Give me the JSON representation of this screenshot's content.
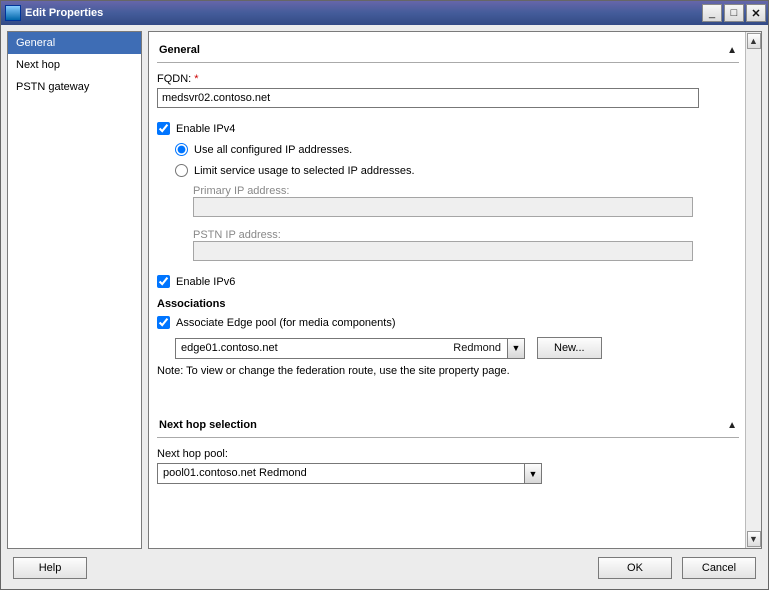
{
  "window": {
    "title": "Edit Properties"
  },
  "sidebar": {
    "items": [
      {
        "label": "General"
      },
      {
        "label": "Next hop"
      },
      {
        "label": "PSTN gateway"
      }
    ]
  },
  "general": {
    "header": "General",
    "fqdn_label": "FQDN:",
    "fqdn_required": "*",
    "fqdn_value": "medsvr02.contoso.net",
    "enable_ipv4_label": "Enable IPv4",
    "ipv4_option_all": "Use all configured IP addresses.",
    "ipv4_option_limit": "Limit service usage to selected IP addresses.",
    "primary_ip_label": "Primary IP address:",
    "primary_ip_value": "",
    "pstn_ip_label": "PSTN IP address:",
    "pstn_ip_value": "",
    "enable_ipv6_label": "Enable IPv6",
    "associations_header": "Associations",
    "associate_edge_label": "Associate Edge pool (for media components)",
    "edge_pool_value": "edge01.contoso.net",
    "edge_pool_site": "Redmond",
    "new_button": "New...",
    "note": "Note: To view or change the federation route, use the site property page."
  },
  "nexthop": {
    "header": "Next hop selection",
    "pool_label": "Next hop pool:",
    "pool_value": "pool01.contoso.net   Redmond"
  },
  "footer": {
    "help": "Help",
    "ok": "OK",
    "cancel": "Cancel"
  }
}
